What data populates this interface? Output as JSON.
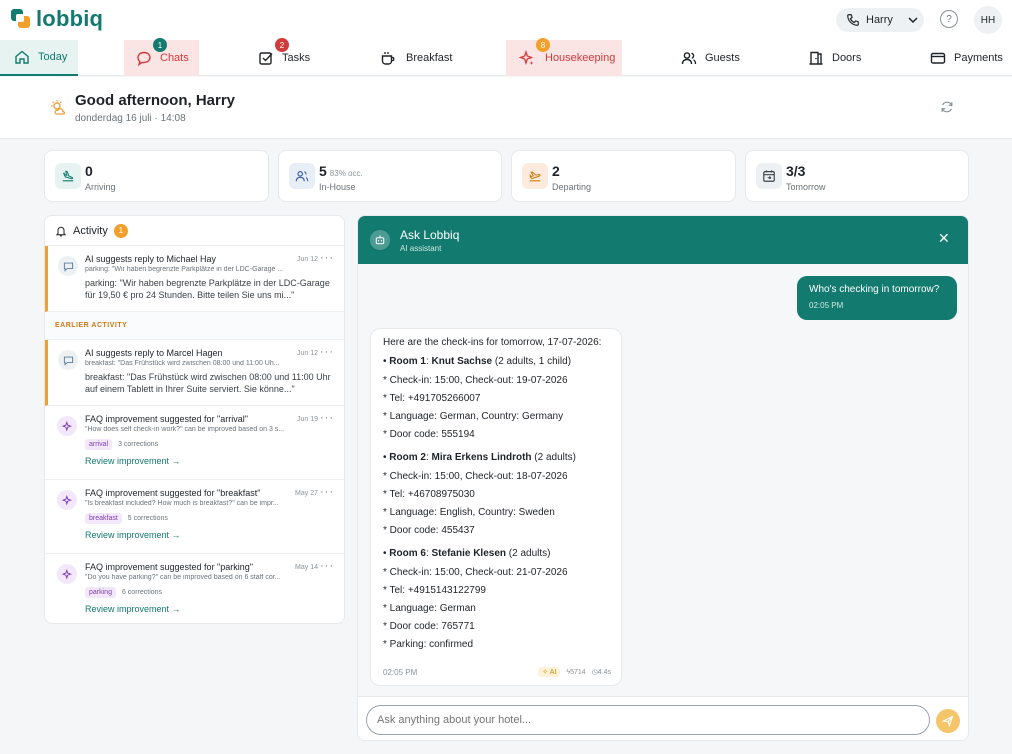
{
  "brand": {
    "name": "lobbiq",
    "color": "#127a6e"
  },
  "header": {
    "user_name": "Harry",
    "avatar_initials": "HH",
    "help": "?"
  },
  "nav": {
    "items": [
      {
        "label": "Today",
        "icon": "home-icon",
        "state": "active"
      },
      {
        "label": "Chats",
        "icon": "chat-icon",
        "state": "alert",
        "badge": "1",
        "badge_color": "#127a6e"
      },
      {
        "label": "Tasks",
        "icon": "check-square-icon",
        "badge": "2",
        "badge_color": "#d23b3b"
      },
      {
        "label": "Breakfast",
        "icon": "cup-icon"
      },
      {
        "label": "Housekeeping",
        "icon": "sparkle-icon",
        "state": "alert",
        "badge": "8",
        "badge_color": "#f2a02b"
      },
      {
        "label": "Guests",
        "icon": "users-icon"
      },
      {
        "label": "Doors",
        "icon": "door-icon"
      },
      {
        "label": "Payments",
        "icon": "card-icon"
      }
    ]
  },
  "greeting": {
    "title": "Good afternoon, Harry",
    "subtitle": "donderdag 16 juli · 14:08"
  },
  "stats": [
    {
      "value": "0",
      "label": "Arriving",
      "icon": "plane-land-icon",
      "bg": "#e6f3f1",
      "color": "#127a6e"
    },
    {
      "value": "5",
      "extra": "83% occ.",
      "label": "In-House",
      "icon": "users-icon",
      "bg": "#e8eef8",
      "color": "#3b5ea8"
    },
    {
      "value": "2",
      "label": "Departing",
      "icon": "plane-depart-icon",
      "bg": "#fcebdc",
      "color": "#d07a12"
    },
    {
      "value": "3/3",
      "label": "Tomorrow",
      "icon": "calendar-icon",
      "bg": "#eef1f3",
      "color": "#3b4147"
    }
  ],
  "activity": {
    "title": "Activity",
    "count": "1",
    "earlier_label": "EARLIER ACTIVITY",
    "recent": [
      {
        "title": "AI suggests reply to Michael Hay",
        "date": "Jun 12",
        "sub": "parking: \"Wir haben begrenzte Parkplätze in der LDC-Garage ...",
        "body": "parking: \"Wir haben begrenzte Parkplätze in der LDC-Garage für 19,50 € pro 24 Stunden. Bitte teilen Sie uns mi...\""
      }
    ],
    "earlier": [
      {
        "type": "reply",
        "title": "AI suggests reply to Marcel Hagen",
        "date": "Jun 12",
        "sub": "breakfast: \"Das Frühstück wird zwischen 08:00 und 11:00 Uh...",
        "body": "breakfast: \"Das Frühstück wird zwischen 08:00 und 11:00 Uhr auf einem Tablett in Ihrer Suite serviert. Sie könne...\""
      },
      {
        "type": "faq",
        "title": "FAQ improvement suggested for \"arrival\"",
        "date": "Jun 19",
        "sub": "\"How does self check-in work?\" can be improved based on 3 s...",
        "tag": "arrival",
        "corrections": "3 corrections",
        "link": "Review improvement →"
      },
      {
        "type": "faq",
        "title": "FAQ improvement suggested for \"breakfast\"",
        "date": "May 27",
        "sub": "\"Is breakfast included? How much is breakfast?\" can be impr...",
        "tag": "breakfast",
        "corrections": "5 corrections",
        "link": "Review improvement →"
      },
      {
        "type": "faq",
        "title": "FAQ improvement suggested for \"parking\"",
        "date": "May 14",
        "sub": "\"Do you have parking?\" can be improved based on 6 staff cor...",
        "tag": "parking",
        "corrections": "6 corrections",
        "link": "Review improvement →"
      }
    ]
  },
  "chat": {
    "title": "Ask Lobbiq",
    "subtitle": "AI assistant",
    "user_message": {
      "text": "Who's checking in tomorrow?",
      "time": "02:05 PM"
    },
    "bot_message": {
      "intro": "Here are the check-ins for tomorrow, 17-07-2026:",
      "rooms": [
        {
          "room": "Room 1",
          "guest": "Knut Sachse",
          "detail": " (2 adults, 1 child)",
          "lines": [
            "* Check-in: 15:00, Check-out: 19-07-2026",
            "* Tel: +491705266007",
            "* Language: German, Country: Germany",
            "* Door code: 555194"
          ]
        },
        {
          "room": "Room 2",
          "guest": "Mira Erkens Lindroth",
          "detail": " (2 adults)",
          "lines": [
            "* Check-in: 15:00, Check-out: 18-07-2026",
            "* Tel: +46708975030",
            "* Language: English, Country: Sweden",
            "* Door code: 455437"
          ]
        },
        {
          "room": "Room 6",
          "guest": "Stefanie Klesen",
          "detail": " (2 adults)",
          "lines": [
            "* Check-in: 15:00, Check-out: 21-07-2026",
            "* Tel: +4915143122799",
            "* Language: German",
            "* Door code: 765771",
            "* Parking: confirmed"
          ]
        }
      ],
      "time": "02:05 PM",
      "ai_label": "AI",
      "tokens": "5714",
      "duration": "4.4s"
    },
    "input_placeholder": "Ask anything about your hotel..."
  }
}
